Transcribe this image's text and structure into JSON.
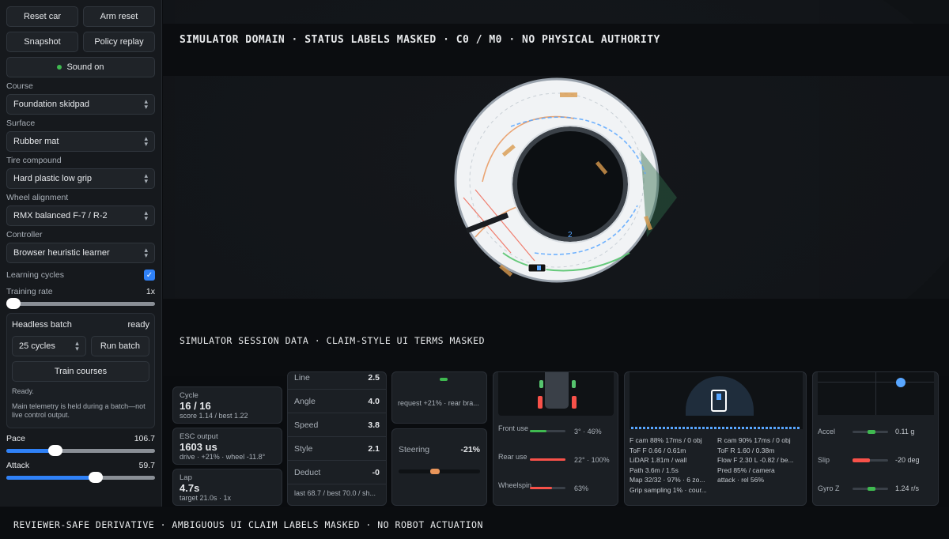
{
  "sidebar": {
    "buttons": {
      "reset_car": "Reset car",
      "arm_reset": "Arm reset",
      "snapshot": "Snapshot",
      "policy_replay": "Policy replay",
      "sound": "Sound on"
    },
    "course": {
      "label": "Course",
      "value": "Foundation skidpad"
    },
    "surface": {
      "label": "Surface",
      "value": "Rubber mat"
    },
    "tire": {
      "label": "Tire compound",
      "value": "Hard plastic low grip"
    },
    "alignment": {
      "label": "Wheel alignment",
      "value": "RMX balanced F-7 / R-2"
    },
    "controller": {
      "label": "Controller",
      "value": "Browser heuristic learner"
    },
    "learning": {
      "label": "Learning cycles",
      "checked": true
    },
    "training_rate": {
      "label": "Training rate",
      "value": "1x",
      "level": 0
    },
    "batch": {
      "title": "Headless batch",
      "status": "ready",
      "cycles": "25 cycles",
      "run": "Run batch",
      "train": "Train courses",
      "ready_text": "Ready.",
      "note": "Main telemetry is held during a batch—not live control output."
    },
    "pace": {
      "label": "Pace",
      "value": "106.7",
      "level": 0.33
    },
    "attack": {
      "label": "Attack",
      "value": "59.7",
      "level": 0.6
    }
  },
  "banners": {
    "top": "SIMULATOR DOMAIN · STATUS LABELS MASKED · C0 / M0 · NO PHYSICAL AUTHORITY",
    "mid": "SIMULATOR SESSION DATA · CLAIM-STYLE UI TERMS MASKED",
    "bottom": "REVIEWER-SAFE DERIVATIVE · AMBIGUOUS UI CLAIM LABELS MASKED · NO ROBOT ACTUATION"
  },
  "track": {
    "marker": "2"
  },
  "stats": {
    "cycle": {
      "label": "Cycle",
      "value": "16 / 16",
      "sub": "score 1.14 / best 1.22"
    },
    "esc": {
      "label": "ESC output",
      "value": "1603 us",
      "sub": "drive · +21% · wheel -11.8°"
    },
    "lap": {
      "label": "Lap",
      "value": "4.7s",
      "sub": "target 21.0s · 1x"
    }
  },
  "score_items": [
    {
      "label": "Line",
      "value": "2.5"
    },
    {
      "label": "Angle",
      "value": "4.0"
    },
    {
      "label": "Speed",
      "value": "3.8"
    },
    {
      "label": "Style",
      "value": "2.1"
    },
    {
      "label": "Deduct",
      "value": "-0"
    }
  ],
  "score_footer": "last 68.7 / best 70.0 / sh...",
  "control": {
    "request": "request +21% · rear bra...",
    "steering_label": "Steering",
    "steering_value": "-21%"
  },
  "tires": [
    {
      "label": "Front use",
      "value": "3° · 46%",
      "color": "#3fb950",
      "level": 0.46
    },
    {
      "label": "Rear use",
      "value": "22° · 100%",
      "color": "#f85149",
      "level": 1.0
    },
    {
      "label": "Wheelspin",
      "value": "63%",
      "color": "#f85149",
      "level": 0.63
    }
  ],
  "sensors": [
    [
      "F cam 88% 17ms / 0 obj",
      "R cam 90% 17ms / 0 obj"
    ],
    [
      "ToF F 0.66 / 0.61m",
      "ToF R 1.60 / 0.38m"
    ],
    [
      "LiDAR 1.81m / wall",
      "Flow F 2.30 L -0.82 / be..."
    ],
    [
      "Path 3.6m / 1.5s",
      "Pred 85% / camera"
    ],
    [
      "Map 32/32 · 97% · 6 zo...",
      "attack · rel 56%"
    ],
    [
      "Grip sampling 1% · cour...",
      ""
    ]
  ],
  "imu": [
    {
      "label": "Accel",
      "value": "0.11 g",
      "color": "#3fb950"
    },
    {
      "label": "Slip",
      "value": "-20 deg",
      "color": "#f85149"
    },
    {
      "label": "Gyro Z",
      "value": "1.24 r/s",
      "color": "#3fb950"
    }
  ]
}
